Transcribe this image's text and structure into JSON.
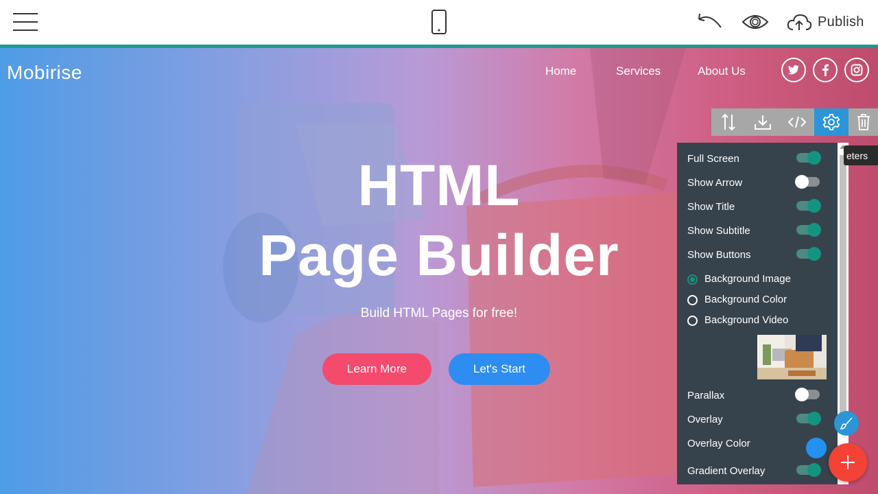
{
  "editor": {
    "menu_icon": "hamburger-icon",
    "device_icon": "mobile-icon",
    "undo_icon": "undo-icon",
    "preview_icon": "eye-icon",
    "publish_label": "Publish",
    "publish_icon": "cloud-upload-icon",
    "accent_color": "#1a9c8a"
  },
  "site": {
    "brand": "Mobirise",
    "nav": [
      "Home",
      "Services",
      "About Us"
    ],
    "social": [
      "twitter-icon",
      "facebook-icon",
      "instagram-icon"
    ],
    "title_line1": "HTML",
    "title_line2": "Page Builder",
    "subtitle": "Build HTML Pages for free!",
    "buttons": [
      {
        "label": "Learn More",
        "color": "#f34a6e"
      },
      {
        "label": "Let's Start",
        "color": "#2d8df0"
      }
    ]
  },
  "block_toolbar": {
    "icons": [
      "reorder-icon",
      "download-icon",
      "code-icon",
      "gear-icon",
      "trash-icon"
    ],
    "active": "gear-icon",
    "tooltip": "eters"
  },
  "params": {
    "toggles_top": [
      {
        "label": "Full Screen",
        "on": true
      },
      {
        "label": "Show Arrow",
        "on": false
      },
      {
        "label": "Show Title",
        "on": true
      },
      {
        "label": "Show Subtitle",
        "on": true
      },
      {
        "label": "Show Buttons",
        "on": true
      }
    ],
    "background_options": [
      {
        "label": "Background Image",
        "checked": true
      },
      {
        "label": "Background Color",
        "checked": false
      },
      {
        "label": "Background Video",
        "checked": false
      }
    ],
    "toggles_bottom": [
      {
        "label": "Parallax",
        "on": false
      },
      {
        "label": "Overlay",
        "on": true
      }
    ],
    "overlay_color_label": "Overlay Color",
    "overlay_color": "#2291f0",
    "gradient_overlay_label": "Gradient Overlay",
    "gradient_overlay_on": true
  },
  "fabs": {
    "brush_icon": "paint-brush-icon",
    "add_icon": "plus-icon"
  }
}
